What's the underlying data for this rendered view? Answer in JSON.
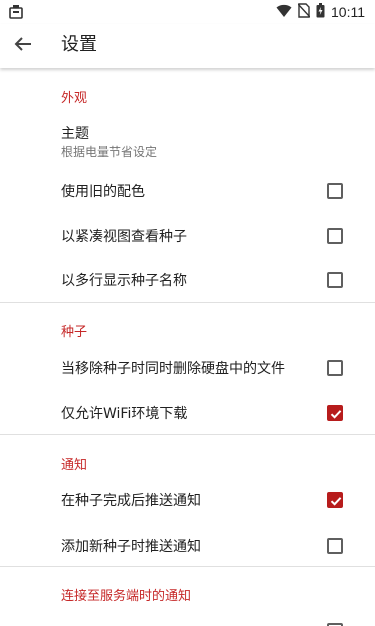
{
  "status_bar": {
    "time": "10:11",
    "left_icon": "notification-icon",
    "right_icons": [
      "wifi-icon",
      "no-sim-icon",
      "battery-icon"
    ]
  },
  "app_bar": {
    "back_icon": "back-arrow-icon",
    "title": "设置"
  },
  "sections": {
    "appearance": {
      "header": "外观",
      "theme_title": "主题",
      "theme_summary": "根据电量节省设定",
      "old_colors_label": "使用旧的配色",
      "old_colors_checked": false,
      "compact_view_label": "以紧凑视图查看种子",
      "compact_view_checked": false,
      "multiline_names_label": "以多行显示种子名称",
      "multiline_names_checked": false
    },
    "torrents": {
      "header": "种子",
      "delete_files_label": "当移除种子时同时删除硬盘中的文件",
      "delete_files_checked": false,
      "wifi_only_label": "仅允许WiFi环境下载",
      "wifi_only_checked": true
    },
    "notifications": {
      "header": "通知",
      "on_complete_label": "在种子完成后推送通知",
      "on_complete_checked": true,
      "on_add_label": "添加新种子时推送通知",
      "on_add_checked": false
    },
    "server_notifications": {
      "header": "连接至服务端时的通知"
    }
  },
  "colors": {
    "accent": "#c62828",
    "checkbox_checked": "#b71c1c",
    "checkbox_unchecked_border": "#5f5f5f"
  }
}
